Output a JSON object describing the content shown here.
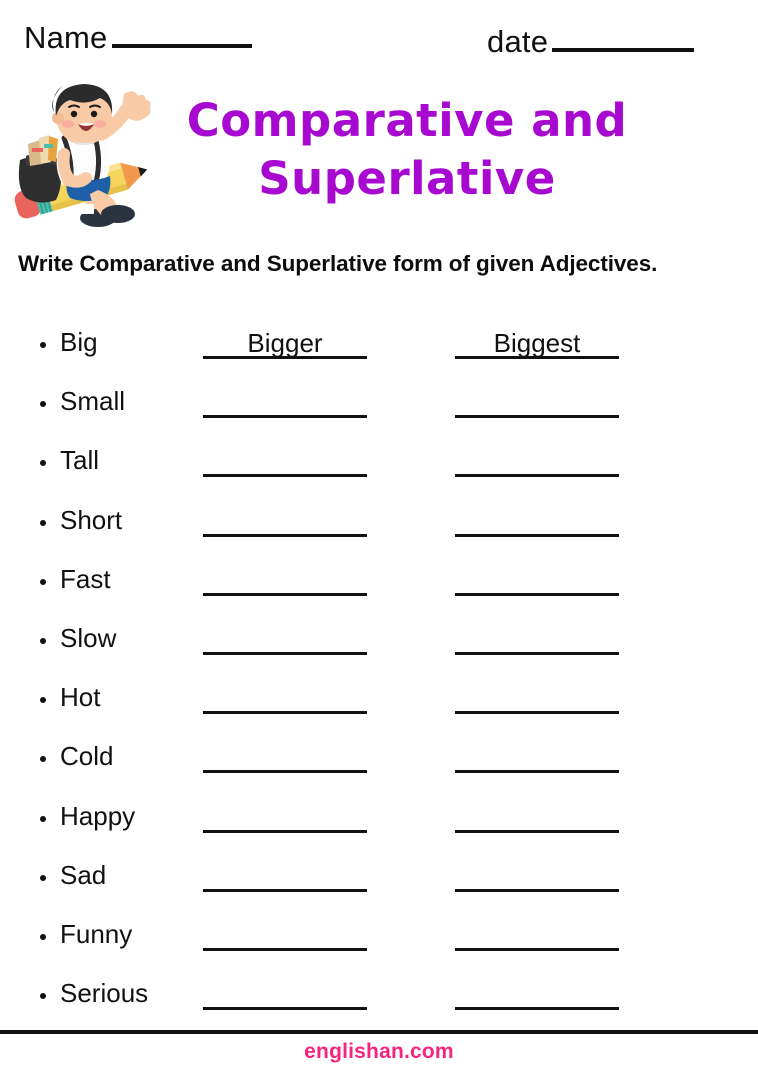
{
  "header": {
    "name_label": "Name",
    "date_label": "date"
  },
  "title": {
    "line1": "Comparative and",
    "line2": "Superlative"
  },
  "instruction": "Write Comparative and Superlative form of given Adjectives.",
  "illustration": {
    "name": "schoolboy-riding-pencil-illustration",
    "colors": {
      "hair": "#2b2b2b",
      "skin": "#f8cba6",
      "shirt": "#fdfdfd",
      "shorts": "#1f5fa8",
      "backpack": "#2e2e2e",
      "pencil_body": "#f6d55c",
      "pencil_tip": "#f0994a",
      "pencil_lead": "#1a1a1a",
      "eraser": "#e8645c",
      "ferrule": "#4bbfae",
      "shoes": "#2b3340"
    }
  },
  "colors": {
    "title_purple": "#a809d0",
    "brand_pink": "#f5257f",
    "ink_black": "#111111"
  },
  "worksheet": {
    "column_headers_visible": false,
    "rows": [
      {
        "adjective": "Big",
        "comparative": "Bigger",
        "superlative": "Biggest"
      },
      {
        "adjective": "Small",
        "comparative": "",
        "superlative": ""
      },
      {
        "adjective": "Tall",
        "comparative": "",
        "superlative": ""
      },
      {
        "adjective": "Short",
        "comparative": "",
        "superlative": ""
      },
      {
        "adjective": "Fast",
        "comparative": "",
        "superlative": ""
      },
      {
        "adjective": "Slow",
        "comparative": "",
        "superlative": ""
      },
      {
        "adjective": "Hot",
        "comparative": "",
        "superlative": ""
      },
      {
        "adjective": "Cold",
        "comparative": "",
        "superlative": ""
      },
      {
        "adjective": "Happy",
        "comparative": "",
        "superlative": ""
      },
      {
        "adjective": "Sad",
        "comparative": "",
        "superlative": ""
      },
      {
        "adjective": "Funny",
        "comparative": "",
        "superlative": ""
      },
      {
        "adjective": "Serious",
        "comparative": "",
        "superlative": ""
      }
    ]
  },
  "footer": {
    "brand": "englishan.com"
  }
}
